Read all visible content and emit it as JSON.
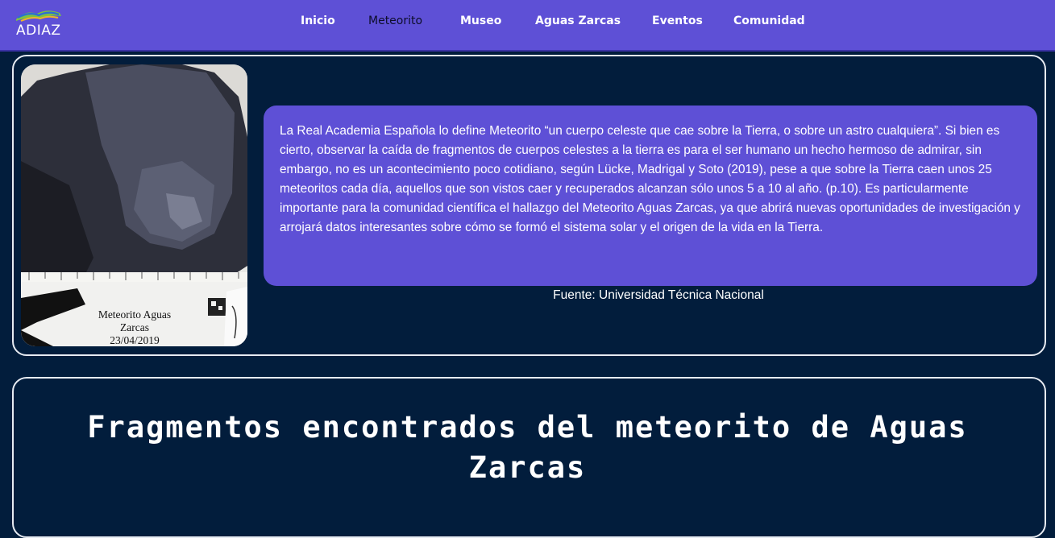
{
  "header": {
    "logo_text": "ADIAZ",
    "nav": [
      {
        "label": "Inicio"
      },
      {
        "label": "Meteorito"
      },
      {
        "label": "Museo"
      },
      {
        "label": "Aguas Zarcas"
      },
      {
        "label": "Eventos"
      },
      {
        "label": "Comunidad"
      }
    ],
    "active_item": "Meteorito"
  },
  "intro": {
    "image_caption_lines": [
      "Meteorito Aguas Zarcas",
      "23/04/2019"
    ],
    "quote": "La Real Academia Española lo define Meteorito “un cuerpo celeste que cae sobre la Tierra, o sobre un astro cualquiera”. Si bien es cierto, observar la caída de fragmentos de cuerpos celestes a la tierra es para el ser humano un hecho hermoso de admirar, sin embargo, no es un acontecimiento poco cotidiano, según Lücke, Madrigal y Soto (2019), pese a que sobre la Tierra caen unos 25 meteoritos cada día, aquellos que son vistos caer y recuperados alcanzan sólo unos 5 a 10 al año. (p.10). Es particularmente importante para la comunidad científica el hallazgo del Meteorito Aguas Zarcas, ya que abrirá nuevas oportunidades de investigación y arrojará datos interesantes sobre cómo se formó el sistema solar y el origen de la vida en la Tierra.",
    "source": "Fuente: Universidad Técnica Nacional"
  },
  "fragments": {
    "title": "Fragmentos encontrados del meteorito de Aguas Zarcas"
  },
  "colors": {
    "nav_bg": "#5e50d6",
    "page_bg": "#021d3c",
    "card_border": "#e7ebf2"
  }
}
